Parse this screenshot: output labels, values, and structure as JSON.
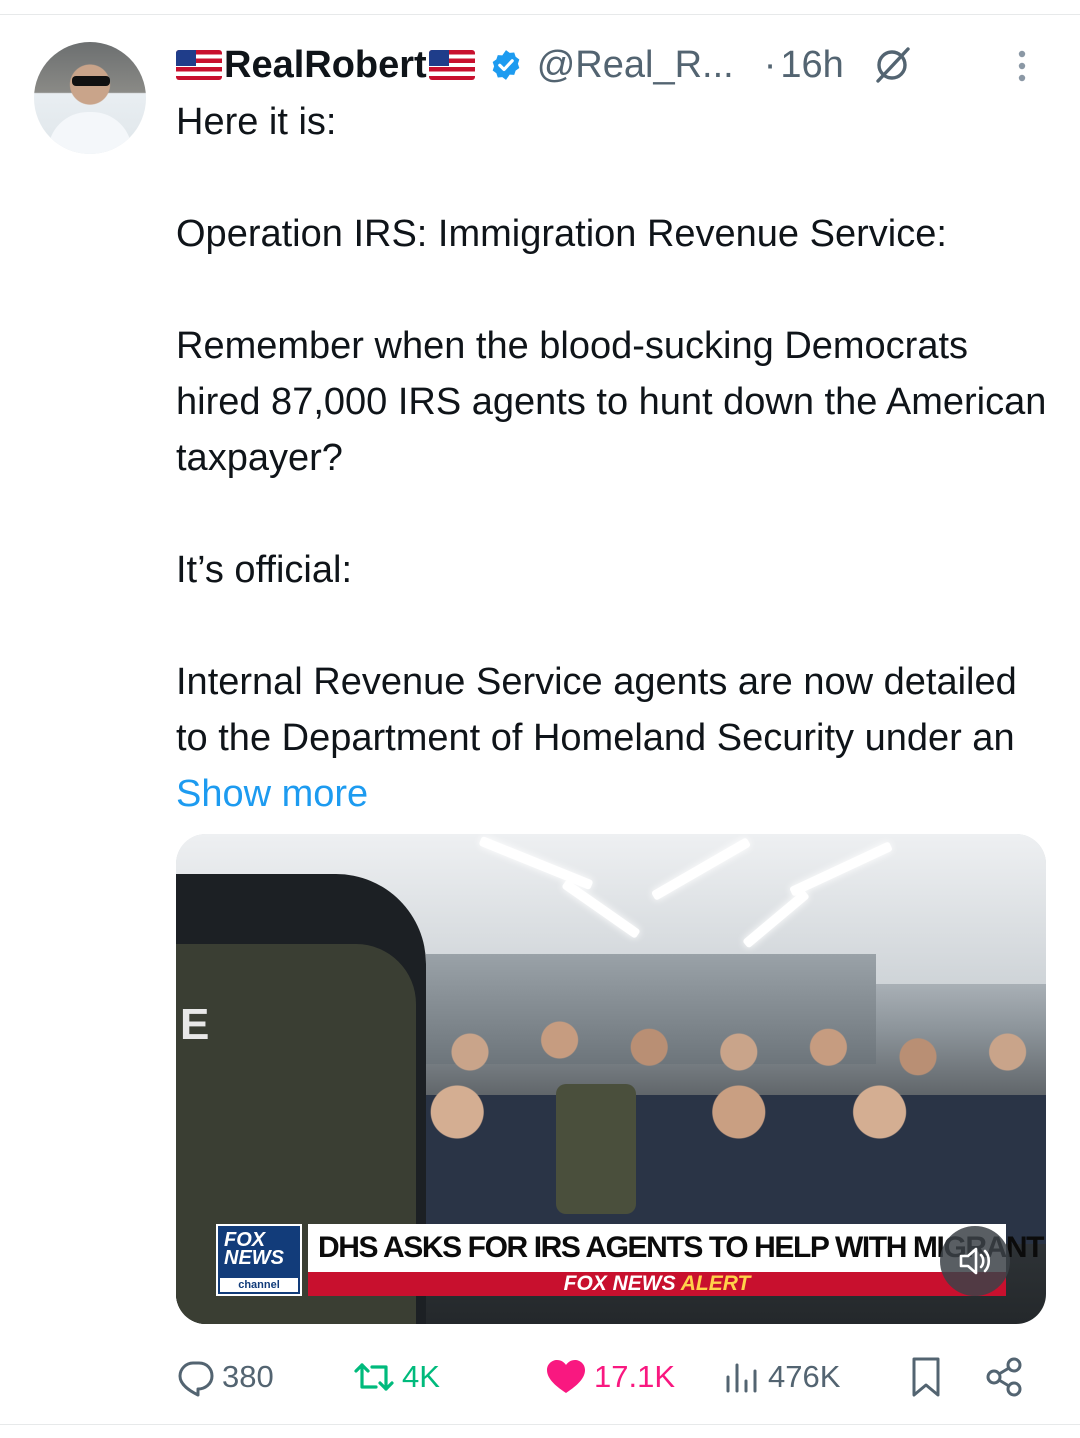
{
  "author": {
    "display_name": "RealRobert",
    "handle": "@Real_R...",
    "separator": "·",
    "time": "16h"
  },
  "tweet": {
    "paragraphs": [
      "Here it is:",
      "Operation IRS: Immigration Revenue Service:",
      "Remember when the blood-sucking Democrats hired 87,000 IRS agents to hunt down the American taxpayer?",
      "It’s official:",
      "Internal Revenue Service agents are now detailed to the Department of Homeland Security under an"
    ],
    "show_more": "Show more"
  },
  "media": {
    "foreground_label": "E",
    "chyron_logo_top": "FOX",
    "chyron_logo_bottom": "NEWS",
    "chyron_logo_sub": "channel",
    "headline": "DHS ASKS FOR IRS AGENTS TO HELP WITH MIGRANT RAIDS",
    "alert_prefix": "FOX NEWS",
    "alert_word": "ALERT"
  },
  "actions": {
    "replies": "380",
    "reposts": "4K",
    "likes": "17.1K",
    "views": "476K"
  },
  "colors": {
    "accent": "#1d9bf0",
    "retweet": "#00ba7c",
    "like": "#f91880",
    "muted": "#536471"
  },
  "icons": [
    "avatar",
    "us-flag-icon",
    "verified-badge-icon",
    "grok-icon",
    "more-icon",
    "speaker-icon",
    "reply-icon",
    "repost-icon",
    "heart-icon",
    "views-icon",
    "bookmark-icon",
    "share-icon"
  ]
}
